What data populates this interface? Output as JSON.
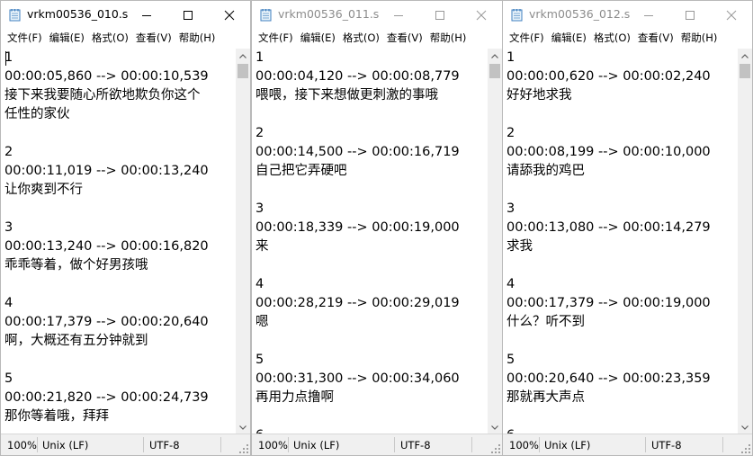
{
  "windows": [
    {
      "title": "vrkm00536_010.s...",
      "active": true,
      "menu": [
        "文件(F)",
        "编辑(E)",
        "格式(O)",
        "查看(V)",
        "帮助(H)"
      ],
      "lines": [
        "1",
        "00:00:05,860 --> 00:00:10,539",
        "接下来我要随心所欲地欺负你这个",
        "任性的家伙",
        "",
        "2",
        "00:00:11,019 --> 00:00:13,240",
        "让你爽到不行",
        "",
        "3",
        "00:00:13,240 --> 00:00:16,820",
        "乖乖等着，做个好男孩哦",
        "",
        "4",
        "00:00:17,379 --> 00:00:20,640",
        "啊，大概还有五分钟就到",
        "",
        "5",
        "00:00:21,820 --> 00:00:24,739",
        "那你等着哦，拜拜"
      ],
      "status": {
        "zoom": "100%",
        "eol": "Unix (LF)",
        "encoding": "UTF-8"
      }
    },
    {
      "title": "vrkm00536_011.s...",
      "active": false,
      "menu": [
        "文件(F)",
        "编辑(E)",
        "格式(O)",
        "查看(V)",
        "帮助(H)"
      ],
      "lines": [
        "1",
        "00:00:04,120 --> 00:00:08,779",
        "喂喂，接下来想做更刺激的事哦",
        "",
        "2",
        "00:00:14,500 --> 00:00:16,719",
        "自己把它弄硬吧",
        "",
        "3",
        "00:00:18,339 --> 00:00:19,000",
        "来",
        "",
        "4",
        "00:00:28,219 --> 00:00:29,019",
        "嗯",
        "",
        "5",
        "00:00:31,300 --> 00:00:34,060",
        "再用力点撸啊",
        "",
        "6"
      ],
      "status": {
        "zoom": "100%",
        "eol": "Unix (LF)",
        "encoding": "UTF-8"
      }
    },
    {
      "title": "vrkm00536_012.s...",
      "active": false,
      "menu": [
        "文件(F)",
        "编辑(E)",
        "格式(O)",
        "查看(V)",
        "帮助(H)"
      ],
      "lines": [
        "1",
        "00:00:00,620 --> 00:00:02,240",
        "好好地求我",
        "",
        "2",
        "00:00:08,199 --> 00:00:10,000",
        "请舔我的鸡巴",
        "",
        "3",
        "00:00:13,080 --> 00:00:14,279",
        "求我",
        "",
        "4",
        "00:00:17,379 --> 00:00:19,000",
        "什么？听不到",
        "",
        "5",
        "00:00:20,640 --> 00:00:23,359",
        "那就再大声点",
        "",
        "6"
      ],
      "status": {
        "zoom": "100%",
        "eol": "Unix (LF)",
        "encoding": "UTF-8"
      }
    }
  ]
}
